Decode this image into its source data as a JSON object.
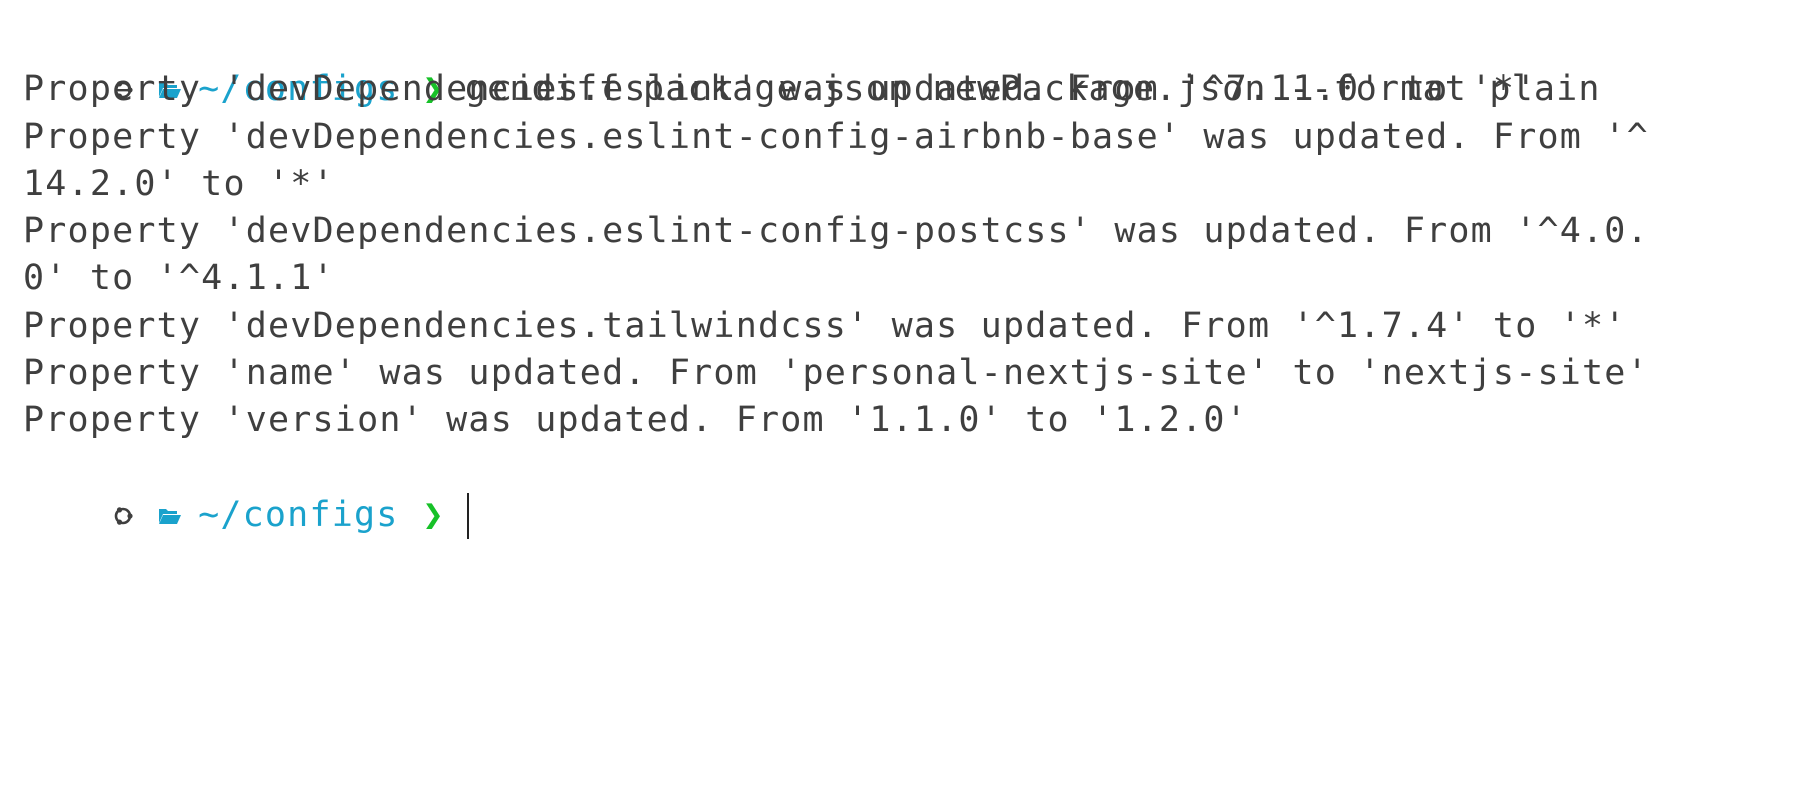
{
  "prompt": {
    "path": "~/configs",
    "chevron": "❯",
    "command": "gendiff package.json newPackage.json --format plain",
    "colors": {
      "path": "#1aa2cc",
      "chevron": "#17c128",
      "folder": "#1aa2cc",
      "text": "#3f3f3f"
    },
    "icons": [
      "os-logo-icon",
      "folder-icon"
    ]
  },
  "output": [
    "Property 'devDependencies.eslint' was updated. From '^7.11.0' to '*'",
    "Property 'devDependencies.eslint-config-airbnb-base' was updated. From '^",
    "14.2.0' to '*'",
    "Property 'devDependencies.eslint-config-postcss' was updated. From '^4.0.",
    "0' to '^4.1.1'",
    "Property 'devDependencies.tailwindcss' was updated. From '^1.7.4' to '*'",
    "Property 'name' was updated. From 'personal-nextjs-site' to 'nextjs-site'",
    "Property 'version' was updated. From '1.1.0' to '1.2.0'"
  ],
  "next_prompt": {
    "path": "~/configs",
    "chevron": "❯"
  }
}
